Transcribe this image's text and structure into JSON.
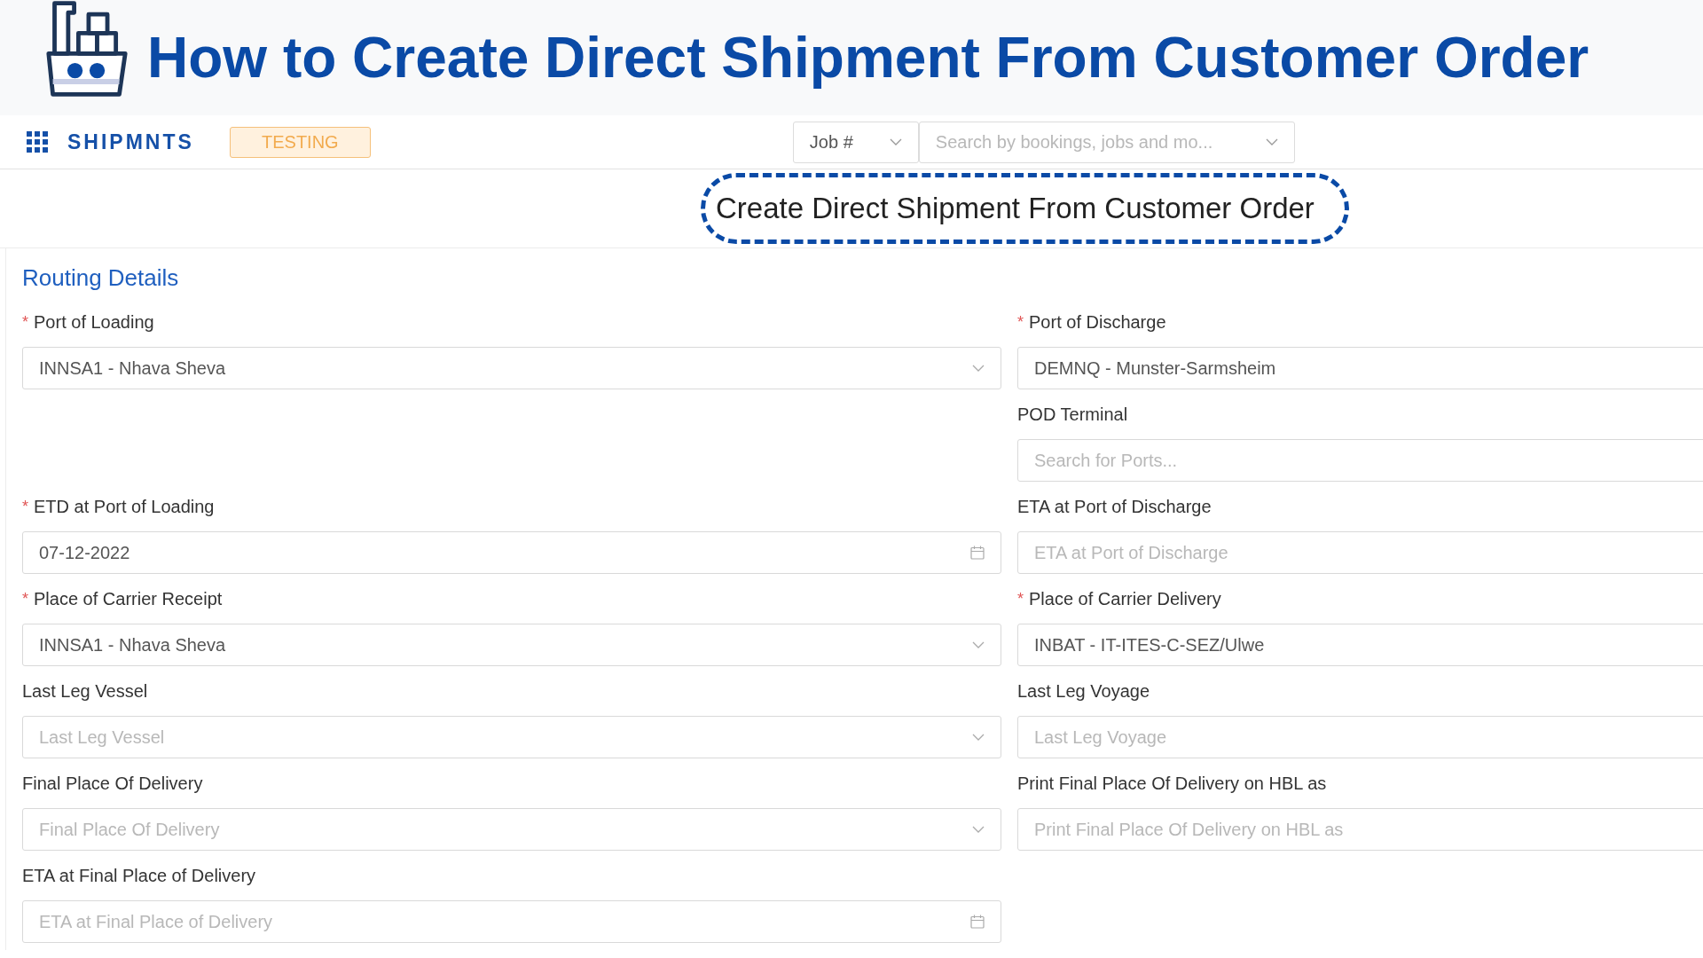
{
  "banner": {
    "title": "How to Create Direct Shipment From Customer Order"
  },
  "navbar": {
    "brand": "SHIPMNTS",
    "environment_badge": "TESTING",
    "search_type": {
      "value": "Job #"
    },
    "search": {
      "placeholder": "Search by bookings, jobs and mo..."
    }
  },
  "page_title": "Create Direct Shipment From Customer Order",
  "section": {
    "title": "Routing Details"
  },
  "rows": [
    {
      "left": {
        "label": "Port of Loading",
        "required_mark": "*",
        "kind": "select",
        "value": "INNSA1 - Nhava Sheva"
      },
      "right": {
        "label": "Port of Discharge",
        "required_mark": "*",
        "value": "DEMNQ - Munster-Sarmsheim"
      }
    },
    {
      "right": {
        "label": "POD Terminal",
        "placeholder": "Search for Ports..."
      }
    },
    {
      "left": {
        "label": "ETD at Port of Loading",
        "required_mark": "*",
        "kind": "date",
        "value": "07-12-2022"
      },
      "right": {
        "label": "ETA at Port of Discharge",
        "placeholder": "ETA at Port of Discharge"
      }
    },
    {
      "left": {
        "label": "Place of Carrier Receipt",
        "required_mark": "*",
        "kind": "select",
        "value": "INNSA1 - Nhava Sheva"
      },
      "right": {
        "label": "Place of Carrier Delivery",
        "required_mark": "*",
        "value": "INBAT - IT-ITES-C-SEZ/Ulwe"
      }
    },
    {
      "left": {
        "label": "Last Leg Vessel",
        "kind": "select",
        "placeholder": "Last Leg Vessel"
      },
      "right": {
        "label": "Last Leg Voyage",
        "placeholder": "Last Leg Voyage"
      }
    },
    {
      "left": {
        "label": "Final Place Of Delivery",
        "kind": "select",
        "placeholder": "Final Place Of Delivery"
      },
      "right": {
        "label": "Print Final Place Of Delivery on HBL as",
        "placeholder": "Print Final Place Of Delivery on HBL as"
      }
    },
    {
      "left": {
        "label": "ETA at Final Place of Delivery",
        "kind": "date",
        "placeholder": "ETA at Final Place of Delivery"
      }
    }
  ]
}
